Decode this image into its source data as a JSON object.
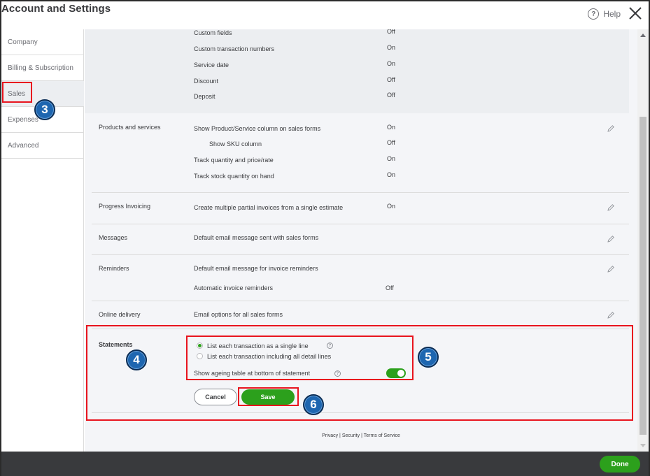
{
  "window": {
    "title": "Account and Settings",
    "help_label": "Help",
    "help_glyph": "?"
  },
  "sidebar": {
    "items": [
      {
        "label": "Company"
      },
      {
        "label": "Billing & Subscription"
      },
      {
        "label": "Sales",
        "active": true
      },
      {
        "label": "Expenses"
      },
      {
        "label": "Advanced"
      }
    ]
  },
  "sales_form_content": {
    "rows": [
      {
        "label": "Custom fields",
        "value": "Off"
      },
      {
        "label": "Custom transaction numbers",
        "value": "On"
      },
      {
        "label": "Service date",
        "value": "On"
      },
      {
        "label": "Discount",
        "value": "Off"
      },
      {
        "label": "Deposit",
        "value": "Off"
      }
    ]
  },
  "products_services": {
    "title": "Products and services",
    "rows": [
      {
        "label": "Show Product/Service column on sales forms",
        "value": "On"
      },
      {
        "label": "Show SKU column",
        "value": "Off"
      },
      {
        "label": "Track quantity and price/rate",
        "value": "On"
      },
      {
        "label": "Track stock quantity on hand",
        "value": "On"
      }
    ]
  },
  "progress_invoicing": {
    "title": "Progress Invoicing",
    "label": "Create multiple partial invoices from a single estimate",
    "value": "On"
  },
  "messages": {
    "title": "Messages",
    "label": "Default email message sent with sales forms"
  },
  "reminders": {
    "title": "Reminders",
    "label": "Default email message for invoice reminders",
    "auto_label": "Automatic invoice reminders",
    "auto_value": "Off"
  },
  "online_delivery": {
    "title": "Online delivery",
    "label": "Email options for all sales forms"
  },
  "statements": {
    "title": "Statements",
    "option_single": "List each transaction as a single line",
    "option_detail": "List each transaction including all detail lines",
    "selected": "single",
    "ageing_label": "Show ageing table at bottom of statement",
    "ageing_on": true,
    "cancel_label": "Cancel",
    "save_label": "Save"
  },
  "footer": {
    "privacy": "Privacy",
    "sep": "|",
    "security": "Security",
    "terms": "Terms of Service"
  },
  "bottom_bar": {
    "done_label": "Done"
  },
  "annotations": {
    "badge_3": "3",
    "badge_4": "4",
    "badge_5": "5",
    "badge_6": "6"
  },
  "colors": {
    "accent_green": "#2ca01c",
    "highlight_red": "#e8141e",
    "badge_blue": "#1e66b0",
    "bottom_bar": "#393a3d"
  }
}
